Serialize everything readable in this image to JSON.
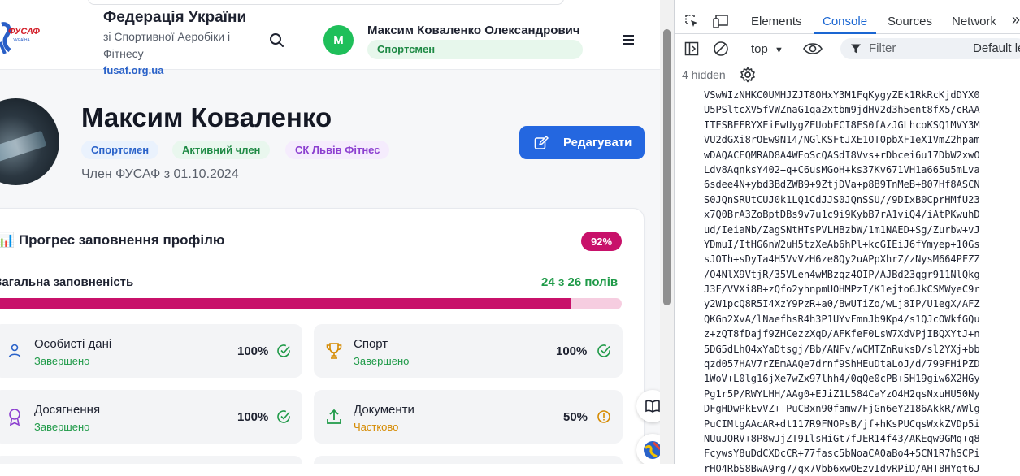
{
  "header": {
    "brand_title": "Федерація України",
    "brand_subtitle": "зі Спортивної Аеробіки і Фітнесу",
    "brand_link": "fusaf.org.ua",
    "logo_text": "ФУСАФ",
    "avatar_initial": "М",
    "user_name": "Максим Коваленко Олександрович",
    "user_role": "Спортсмен"
  },
  "profile": {
    "name": "Максим Коваленко",
    "chips": [
      "Спортсмен",
      "Активний член",
      "СК Львів Фітнес"
    ],
    "member_since": "Член ФУСАФ з 01.10.2024",
    "edit_button": "Редагувати"
  },
  "progress": {
    "icon": "📊",
    "title": "Прогрес заповнення профілю",
    "badge": "92%",
    "overall_label": "Загальна заповненість",
    "overall_count": "24 з 26 полів",
    "fill_fraction": 0.92,
    "sections": [
      {
        "name": "Особисті дані",
        "state": "Завершено",
        "pct": "100%",
        "icon": "user-icon",
        "status_icon": "check-circle-icon"
      },
      {
        "name": "Спорт",
        "state": "Завершено",
        "pct": "100%",
        "icon": "trophy-icon",
        "status_icon": "check-circle-icon"
      },
      {
        "name": "Досягнення",
        "state": "Завершено",
        "pct": "100%",
        "icon": "medal-icon",
        "status_icon": "check-circle-icon"
      },
      {
        "name": "Документи",
        "state": "Частково",
        "pct": "50%",
        "icon": "upload-icon",
        "status_icon": "alert-circle-icon"
      }
    ]
  },
  "devtools": {
    "tabs": [
      "Elements",
      "Console",
      "Sources",
      "Network"
    ],
    "active_tab": "Console",
    "context": "top",
    "filter_placeholder": "Filter",
    "levels": "Default le",
    "hidden_count": "4 hidden",
    "log_lines": [
      "VSwWIzNHKC0UMHJZJT8OHxY3M1FqKygyZEk1RkRcKjdDYX0",
      "U5PSltcXV5fVWZnaG1qa2xtbm9jdHV2d3h5ent8fX5/cRAA",
      "ITESBEFRYXEiEwUygZEUobFCI8FS0fAzJGLhcoKSQ1MVY3M",
      "VU2dGXi8rOEw9N14/NGlKSFtJXE1OT0pbXF1eX1VmZ2hpam",
      "wDAQACEQMRAD8A4WEoScQASdI8Vvs+rDbcei6u17DbW2xwO",
      "Ldv8AqnksY402+q+C6usMGoH+ks37Kv671VH1a665u5mLva",
      "6sdee4N+ybd3BdZWB9+9ZtjDVa+p8B9TnMeB+807Hf8ASCN",
      "S0JQnSRUtCUJ0k1LQ1CdJJS0JQnSSU//9DIxB0CprHMfU23",
      "x7Q0BrA3ZoBptDBs9v7u1c9i9KybB7rA1viQ4/iAtPKwuhD",
      "ud/IeiaNb/ZagSNtHTsPVLHBzbW/1m1NAED+Sg/Zurbw+vJ",
      "YDmuI/ItHG6nW2uH5tzXeAb6hPl+kcGIEiJ6fYmyep+10Gs",
      "sJOTh+sDyIa4H5VvVzH6ze8Qy2uAPpXhrZ/zNysM664PFZZ",
      "/O4NlX9VtjR/35VLen4wMBzqz4OIP/AJBd23qgr911NlQkg",
      "J3F/VVXi8B+zQfo2yhnpmUOHMPzI/K1ejto6JkCSMWyeC9r",
      "y2W1pcQ8R5I4XzY9PzR+a0/BwUTiZo/wLj8IP/U1egX/AFZ",
      "QKGn2XvA/lNaefhsR4h3P1UYvFmnJb9Kp4/s1QJcOWkfGQu",
      "z+zQT8fDajf9ZHCezzXqD/AFKfeF0LsW7XdVPjIBQXYtJ+n",
      "5DG5dLhQ4xYaDtsgj/Bb/ANFv/wCMTZnRuksD/sl2YXj+bb",
      "qzd057HAV7rZEmAAQe7drnf9ShHEuDtaLoJ/d/799FHiPZD",
      "1WoV+L0lg16jXe7wZx97lhh4/0qQe0cPB+5H19giw6X2HGy",
      "Pg1r5P/RWYLHH/AAg0+EJiZ1L584CaYzO4H2qsNxuHU50Ny",
      "DFgHDwPkEvVZ++PuCBxn90famw7FjGn6eY2186AkkR/WWlg",
      "PuCIMtgAAcAR+dt117R9FNOPsB/jf+hKsPUCqsWxkZVDp5i",
      "NUuJORV+8P8wJjZT9IlsHiGt7fJER14f43/AKEqw9GMq+q8",
      "FcywsY8uDdCXDcCR+77fasc5bNoaCA0aBo4+5CN1R7hSCPi",
      "rHO4RbS8BwA9rg7/qx7Vbb6xwOEzvIdvRPiD/AHT8HYqt6J"
    ]
  }
}
